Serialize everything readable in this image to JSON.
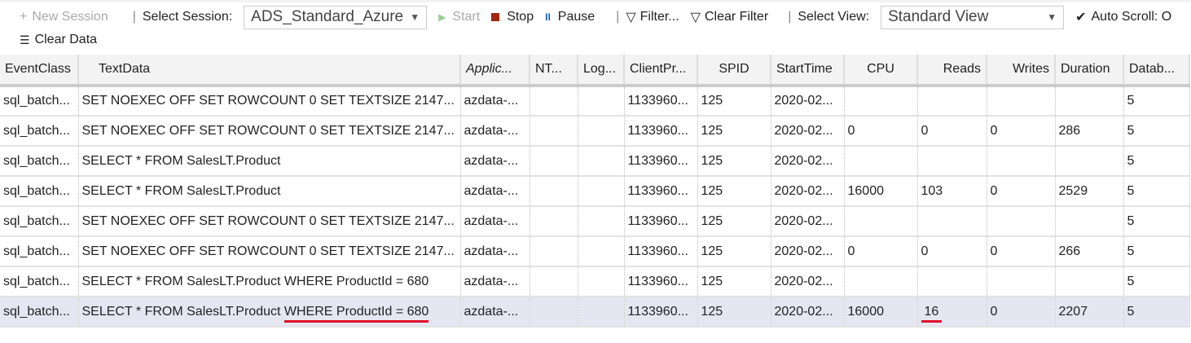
{
  "toolbar": {
    "new_session": "New Session",
    "select_session_label": "Select Session:",
    "session_value": "ADS_Standard_Azure",
    "start": "Start",
    "stop": "Stop",
    "pause": "Pause",
    "filter": "Filter...",
    "clear_filter": "Clear Filter",
    "select_view_label": "Select View:",
    "view_value": "Standard View",
    "auto_scroll": "Auto Scroll: O",
    "clear_data": "Clear Data"
  },
  "columns": [
    "EventClass",
    "TextData",
    "Applic...",
    "NT...",
    "Log...",
    "ClientPr...",
    "SPID",
    "StartTime",
    "CPU",
    "Reads",
    "Writes",
    "Duration",
    "Datab..."
  ],
  "rows": [
    [
      "sql_batch...",
      "SET NOEXEC OFF SET ROWCOUNT 0 SET TEXTSIZE 2147...",
      "azdata-...",
      "",
      "",
      "1133960...",
      "125",
      "2020-02...",
      "",
      "",
      "",
      "",
      "5"
    ],
    [
      "sql_batch...",
      "SET NOEXEC OFF SET ROWCOUNT 0 SET TEXTSIZE 2147...",
      "azdata-...",
      "",
      "",
      "1133960...",
      "125",
      "2020-02...",
      "0",
      "0",
      "0",
      "286",
      "5"
    ],
    [
      "sql_batch...",
      "SELECT * FROM SalesLT.Product",
      "azdata-...",
      "",
      "",
      "1133960...",
      "125",
      "2020-02...",
      "",
      "",
      "",
      "",
      "5"
    ],
    [
      "sql_batch...",
      "SELECT * FROM SalesLT.Product",
      "azdata-...",
      "",
      "",
      "1133960...",
      "125",
      "2020-02...",
      "16000",
      "103",
      "0",
      "2529",
      "5"
    ],
    [
      "sql_batch...",
      "SET NOEXEC OFF SET ROWCOUNT 0 SET TEXTSIZE 2147...",
      "azdata-...",
      "",
      "",
      "1133960...",
      "125",
      "2020-02...",
      "",
      "",
      "",
      "",
      "5"
    ],
    [
      "sql_batch...",
      "SET NOEXEC OFF SET ROWCOUNT 0 SET TEXTSIZE 2147...",
      "azdata-...",
      "",
      "",
      "1133960...",
      "125",
      "2020-02...",
      "0",
      "0",
      "0",
      "266",
      "5"
    ],
    [
      "sql_batch...",
      "SELECT * FROM SalesLT.Product WHERE ProductId = 680",
      "azdata-...",
      "",
      "",
      "1133960...",
      "125",
      "2020-02...",
      "",
      "",
      "",
      "",
      "5"
    ],
    [
      "sql_batch...",
      "SELECT * FROM SalesLT.Product WHERE ProductId = 680",
      "azdata-...",
      "",
      "",
      "1133960...",
      "125",
      "2020-02...",
      "16000",
      "16",
      "0",
      "2207",
      "5"
    ]
  ],
  "last_row_text_prefix": "SELECT * FROM SalesLT.Product ",
  "last_row_text_highlight": "WHERE ProductId = 680"
}
